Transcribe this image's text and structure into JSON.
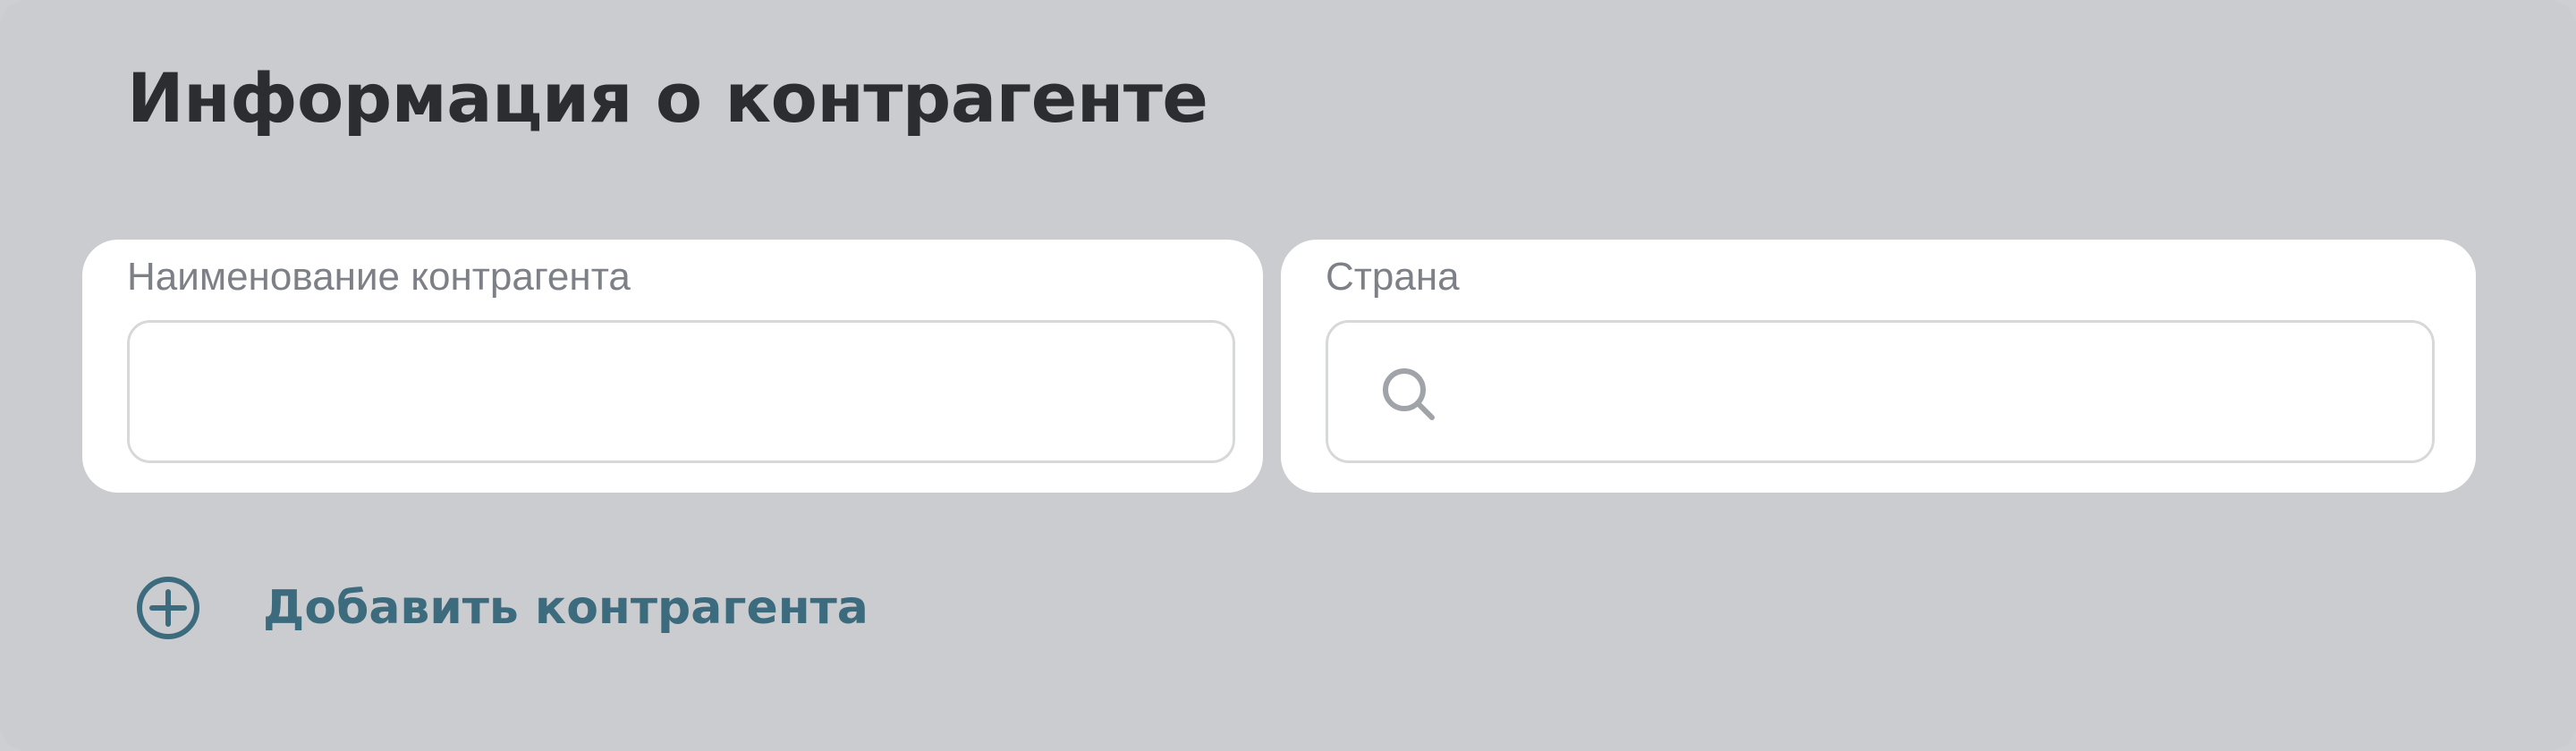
{
  "section": {
    "title": "Информация о контрагенте"
  },
  "form": {
    "counterparty_name": {
      "label": "Наименование контрагента",
      "value": "",
      "placeholder": ""
    },
    "country": {
      "label": "Страна",
      "value": "",
      "placeholder": "",
      "icon": "search-icon"
    }
  },
  "actions": {
    "add_counterparty_label": "Добавить контрагента",
    "add_icon": "plus-circle-icon"
  },
  "colors": {
    "background": "#cbcccf",
    "card": "#ffffff",
    "title": "#2b2d31",
    "label": "#7d8086",
    "input_border": "#d7d8da",
    "accent": "#3c6b7e",
    "icon_muted": "#a0a3a8"
  }
}
